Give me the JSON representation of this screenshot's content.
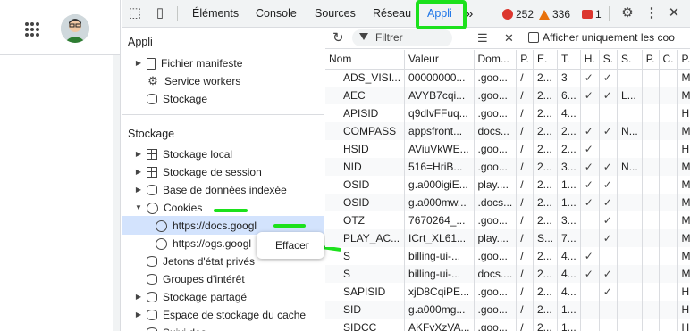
{
  "devtools_tabs": [
    "Éléments",
    "Console",
    "Sources",
    "Réseau",
    "Appli"
  ],
  "more_tabs": "»",
  "badges": {
    "errors": "252",
    "warnings": "336",
    "issues": "1"
  },
  "sidebar": {
    "app_title": "Appli",
    "app_items": [
      "Fichier manifeste",
      "Service workers",
      "Stockage"
    ],
    "storage_title": "Stockage",
    "storage_items": [
      "Stockage local",
      "Stockage de session",
      "Base de données indexée",
      "Cookies"
    ],
    "cookie_sites": [
      "https://docs.googl",
      "https://ogs.googl"
    ],
    "more_items": [
      "Jetons d'état privés",
      "Groupes d'intérêt",
      "Stockage partagé",
      "Espace de stockage du cache",
      "Suivi des"
    ]
  },
  "context_menu": {
    "clear_label": "Effacer"
  },
  "filterbar": {
    "filter_placeholder": "Filtrer",
    "only_show_label": "Afficher uniquement les coo"
  },
  "table": {
    "headers": [
      "Nom",
      "Valeur",
      "Dom...",
      "P.",
      "E.",
      "T.",
      "H.",
      "S.",
      "S.",
      "P.",
      "C.",
      "P."
    ],
    "rows": [
      [
        "ADS_VISI...",
        "00000000...",
        ".goo...",
        "/",
        "2...",
        "3",
        "✓",
        "✓",
        "",
        "",
        "",
        "M."
      ],
      [
        "AEC",
        "AVYB7cqi...",
        ".goo...",
        "/",
        "2...",
        "6...",
        "✓",
        "✓",
        "L...",
        "",
        "",
        "M."
      ],
      [
        "APISID",
        "q9dlvFFuq...",
        ".goo...",
        "/",
        "2...",
        "4...",
        "",
        "",
        "",
        "",
        "",
        "H."
      ],
      [
        "COMPASS",
        "appsfront...",
        "docs...",
        "/",
        "2...",
        "2...",
        "✓",
        "✓",
        "N...",
        "",
        "",
        "M."
      ],
      [
        "HSID",
        "AViuVkWE...",
        ".goo...",
        "/",
        "2...",
        "2...",
        "✓",
        "",
        "",
        "",
        "",
        "H."
      ],
      [
        "NID",
        "516=HriB...",
        ".goo...",
        "/",
        "2...",
        "3...",
        "✓",
        "✓",
        "N...",
        "",
        "",
        "M."
      ],
      [
        "OSID",
        "g.a000igiE...",
        "play....",
        "/",
        "2...",
        "1...",
        "✓",
        "✓",
        "",
        "",
        "",
        "M."
      ],
      [
        "OSID",
        "g.a000mw...",
        ".docs...",
        "/",
        "2...",
        "1...",
        "✓",
        "✓",
        "",
        "",
        "",
        "M."
      ],
      [
        "OTZ",
        "7670264_...",
        ".goo...",
        "/",
        "2...",
        "3...",
        "",
        "✓",
        "",
        "",
        "",
        "M."
      ],
      [
        "PLAY_AC...",
        "ICrt_XL61...",
        "play....",
        "/",
        "S...",
        "7...",
        "",
        "✓",
        "",
        "",
        "",
        "M."
      ],
      [
        "S",
        "billing-ui-...",
        ".goo...",
        "/",
        "2...",
        "4...",
        "✓",
        "",
        "",
        "",
        "",
        "M."
      ],
      [
        "S",
        "billing-ui-...",
        "docs....",
        "/",
        "2...",
        "4...",
        "✓",
        "✓",
        "",
        "",
        "",
        "M."
      ],
      [
        "SAPISID",
        "xjD8CqiPE...",
        ".goo...",
        "/",
        "2...",
        "4...",
        "",
        "✓",
        "",
        "",
        "",
        "H."
      ],
      [
        "SID",
        "g.a000mg...",
        ".goo...",
        "/",
        "2...",
        "1...",
        "",
        "",
        "",
        "",
        "",
        "H."
      ],
      [
        "SIDCC",
        "AKFyXzVA...",
        ".goo...",
        "/",
        "2...",
        "1...",
        "",
        "",
        "",
        "",
        "",
        "H."
      ]
    ]
  },
  "colors": {
    "accent": "#1a73e8",
    "highlight": "#1ce11c",
    "selected": "#d3e3fd"
  }
}
